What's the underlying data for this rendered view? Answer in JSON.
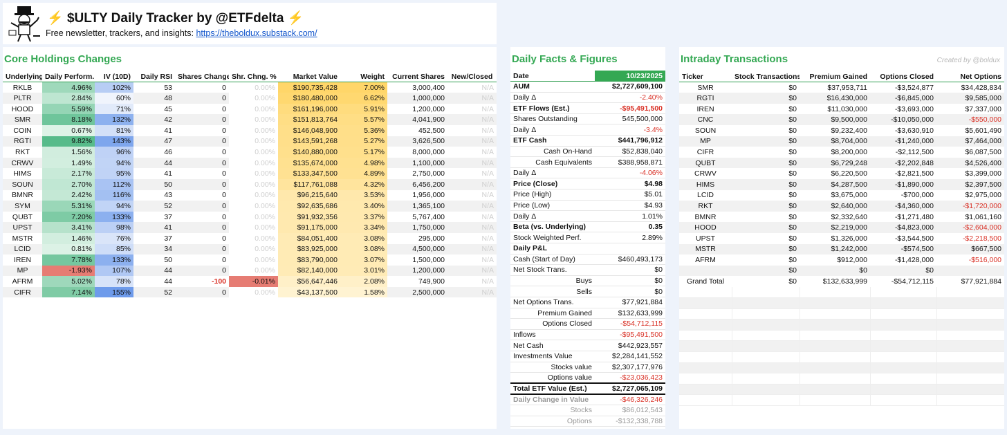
{
  "header": {
    "title": "$ULTY Daily Tracker by @ETFdelta",
    "bolt": "⚡",
    "subtitle": "Free newsletter, trackers, and insights: ",
    "link": "https://theboldux.substack.com/"
  },
  "core": {
    "title": "Core Holdings Changes",
    "columns": [
      "Underlying",
      "Daily Perform.",
      "IV (10D)",
      "Daily RSI",
      "Shares Change",
      "Shr. Chng. %",
      "Market Value",
      "Weight",
      "Current Shares",
      "New/Closed"
    ],
    "rows": [
      [
        "RKLB",
        "4.96%",
        "102%",
        "53",
        "0",
        "0.00%",
        "$190,735,428",
        "7.00%",
        "3,000,400",
        "N/A"
      ],
      [
        "PLTR",
        "2.84%",
        "60%",
        "48",
        "0",
        "0.00%",
        "$180,480,000",
        "6.62%",
        "1,000,000",
        "N/A"
      ],
      [
        "HOOD",
        "5.59%",
        "71%",
        "45",
        "0",
        "0.00%",
        "$161,196,000",
        "5.91%",
        "1,200,000",
        "N/A"
      ],
      [
        "SMR",
        "8.18%",
        "132%",
        "42",
        "0",
        "0.00%",
        "$151,813,764",
        "5.57%",
        "4,041,900",
        "N/A"
      ],
      [
        "COIN",
        "0.67%",
        "81%",
        "41",
        "0",
        "0.00%",
        "$146,048,900",
        "5.36%",
        "452,500",
        "N/A"
      ],
      [
        "RGTI",
        "9.82%",
        "143%",
        "47",
        "0",
        "0.00%",
        "$143,591,268",
        "5.27%",
        "3,626,500",
        "N/A"
      ],
      [
        "RKT",
        "1.56%",
        "96%",
        "46",
        "0",
        "0.00%",
        "$140,880,000",
        "5.17%",
        "8,000,000",
        "N/A"
      ],
      [
        "CRWV",
        "1.49%",
        "94%",
        "44",
        "0",
        "0.00%",
        "$135,674,000",
        "4.98%",
        "1,100,000",
        "N/A"
      ],
      [
        "HIMS",
        "2.17%",
        "95%",
        "41",
        "0",
        "0.00%",
        "$133,347,500",
        "4.89%",
        "2,750,000",
        "N/A"
      ],
      [
        "SOUN",
        "2.70%",
        "112%",
        "50",
        "0",
        "0.00%",
        "$117,761,088",
        "4.32%",
        "6,456,200",
        "N/A"
      ],
      [
        "BMNR",
        "2.42%",
        "116%",
        "43",
        "0",
        "0.00%",
        "$96,215,640",
        "3.53%",
        "1,956,000",
        "N/A"
      ],
      [
        "SYM",
        "5.31%",
        "94%",
        "52",
        "0",
        "0.00%",
        "$92,635,686",
        "3.40%",
        "1,365,100",
        "N/A"
      ],
      [
        "QUBT",
        "7.20%",
        "133%",
        "37",
        "0",
        "0.00%",
        "$91,932,356",
        "3.37%",
        "5,767,400",
        "N/A"
      ],
      [
        "UPST",
        "3.41%",
        "98%",
        "41",
        "0",
        "0.00%",
        "$91,175,000",
        "3.34%",
        "1,750,000",
        "N/A"
      ],
      [
        "MSTR",
        "1.46%",
        "76%",
        "37",
        "0",
        "0.00%",
        "$84,051,400",
        "3.08%",
        "295,000",
        "N/A"
      ],
      [
        "LCID",
        "0.81%",
        "85%",
        "34",
        "0",
        "0.00%",
        "$83,925,000",
        "3.08%",
        "4,500,000",
        "N/A"
      ],
      [
        "IREN",
        "7.78%",
        "133%",
        "50",
        "0",
        "0.00%",
        "$83,790,000",
        "3.07%",
        "1,500,000",
        "N/A"
      ],
      [
        "MP",
        "-1.93%",
        "107%",
        "44",
        "0",
        "0.00%",
        "$82,140,000",
        "3.01%",
        "1,200,000",
        "N/A"
      ],
      [
        "AFRM",
        "5.02%",
        "78%",
        "44",
        "-100",
        "-0.01%",
        "$56,647,446",
        "2.08%",
        "749,900",
        "N/A"
      ],
      [
        "CIFR",
        "7.14%",
        "155%",
        "52",
        "0",
        "0.00%",
        "$43,137,500",
        "1.58%",
        "2,500,000",
        "N/A"
      ]
    ]
  },
  "facts": {
    "title": "Daily Facts & Figures",
    "date_label": "Date",
    "date_value": "10/23/2025",
    "rows": [
      [
        "AUM",
        "$2,727,609,100",
        "sec",
        ""
      ],
      [
        "Daily Δ",
        "-2.40%",
        "",
        "neg"
      ],
      [
        "ETF Flows (Est.)",
        "-$95,491,500",
        "sec",
        "neg"
      ],
      [
        "Shares Outstanding",
        "545,500,000",
        "",
        ""
      ],
      [
        "Daily Δ",
        "-3.4%",
        "",
        "neg"
      ],
      [
        "ETF Cash",
        "$441,796,912",
        "sec",
        ""
      ],
      [
        "Cash On-Hand",
        "$52,838,040",
        "sub",
        ""
      ],
      [
        "Cash Equivalents",
        "$388,958,871",
        "sub",
        ""
      ],
      [
        "Daily Δ",
        "-4.06%",
        "",
        "neg"
      ],
      [
        "Price (Close)",
        "$4.98",
        "sec",
        ""
      ],
      [
        "Price (High)",
        "$5.01",
        "",
        ""
      ],
      [
        "Price (Low)",
        "$4.93",
        "",
        ""
      ],
      [
        "Daily Δ",
        "1.01%",
        "",
        ""
      ],
      [
        "Beta (vs. Underlying)",
        "0.35",
        "sec",
        ""
      ],
      [
        "Stock Weighted Perf.",
        "2.89%",
        "",
        ""
      ],
      [
        "Daily P&L",
        "",
        "sec",
        ""
      ],
      [
        "Cash (Start of Day)",
        "$460,493,173",
        "",
        ""
      ],
      [
        "Net Stock Trans.",
        "$0",
        "",
        ""
      ],
      [
        "Buys",
        "$0",
        "sub2",
        ""
      ],
      [
        "Sells",
        "$0",
        "sub2",
        ""
      ],
      [
        "Net Options Trans.",
        "$77,921,884",
        "",
        ""
      ],
      [
        "Premium Gained",
        "$132,633,999",
        "sub",
        ""
      ],
      [
        "Options Closed",
        "-$54,712,115",
        "sub",
        "neg"
      ],
      [
        "Inflows",
        "-$95,491,500",
        "",
        "neg"
      ],
      [
        "Net Cash",
        "$442,923,557",
        "",
        ""
      ],
      [
        "Investments Value",
        "$2,284,141,552",
        "",
        ""
      ],
      [
        "Stocks value",
        "$2,307,177,976",
        "sub",
        ""
      ],
      [
        "Options value",
        "-$23,036,423",
        "sub",
        "neg"
      ],
      [
        "Total ETF Value (Est.)",
        "$2,727,065,109",
        "strong",
        ""
      ],
      [
        "Daily Change in Value",
        "-$46,326,246",
        "dcv",
        "neg"
      ],
      [
        "Stocks",
        "$86,012,543",
        "graysub",
        ""
      ],
      [
        "Options",
        "-$132,338,788",
        "graysub",
        ""
      ]
    ]
  },
  "intraday": {
    "title": "Intraday Transactions",
    "credit": "Created by @boldux",
    "columns": [
      "Ticker",
      "Stock Transactions",
      "Premium Gained",
      "Options Closed",
      "Net Options"
    ],
    "rows": [
      [
        "SMR",
        "$0",
        "$37,953,711",
        "-$3,524,877",
        "$34,428,834"
      ],
      [
        "RGTI",
        "$0",
        "$16,430,000",
        "-$6,845,000",
        "$9,585,000"
      ],
      [
        "IREN",
        "$0",
        "$11,030,000",
        "-$3,693,000",
        "$7,337,000"
      ],
      [
        "CNC",
        "$0",
        "$9,500,000",
        "-$10,050,000",
        "-$550,000"
      ],
      [
        "SOUN",
        "$0",
        "$9,232,400",
        "-$3,630,910",
        "$5,601,490"
      ],
      [
        "MP",
        "$0",
        "$8,704,000",
        "-$1,240,000",
        "$7,464,000"
      ],
      [
        "CIFR",
        "$0",
        "$8,200,000",
        "-$2,112,500",
        "$6,087,500"
      ],
      [
        "QUBT",
        "$0",
        "$6,729,248",
        "-$2,202,848",
        "$4,526,400"
      ],
      [
        "CRWV",
        "$0",
        "$6,220,500",
        "-$2,821,500",
        "$3,399,000"
      ],
      [
        "HIMS",
        "$0",
        "$4,287,500",
        "-$1,890,000",
        "$2,397,500"
      ],
      [
        "LCID",
        "$0",
        "$3,675,000",
        "-$700,000",
        "$2,975,000"
      ],
      [
        "RKT",
        "$0",
        "$2,640,000",
        "-$4,360,000",
        "-$1,720,000"
      ],
      [
        "BMNR",
        "$0",
        "$2,332,640",
        "-$1,271,480",
        "$1,061,160"
      ],
      [
        "HOOD",
        "$0",
        "$2,219,000",
        "-$4,823,000",
        "-$2,604,000"
      ],
      [
        "UPST",
        "$0",
        "$1,326,000",
        "-$3,544,500",
        "-$2,218,500"
      ],
      [
        "MSTR",
        "$0",
        "$1,242,000",
        "-$574,500",
        "$667,500"
      ],
      [
        "AFRM",
        "$0",
        "$912,000",
        "-$1,428,000",
        "-$516,000"
      ],
      [
        "",
        "$0",
        "$0",
        "$0",
        ""
      ],
      [
        "Grand Total",
        "$0",
        "$132,633,999",
        "-$54,712,115",
        "$77,921,884"
      ]
    ]
  },
  "colors": {
    "accent_green": "#34a853",
    "date_fill": "#34a853",
    "negative": "#d93025"
  }
}
